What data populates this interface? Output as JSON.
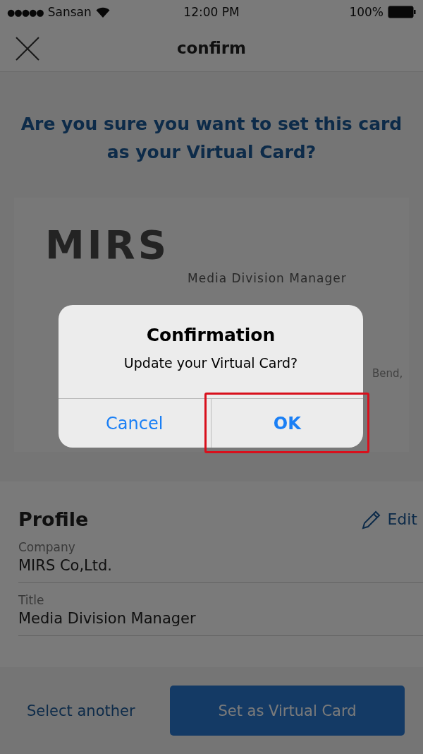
{
  "status_bar": {
    "signal_dots": "●●●●●",
    "carrier": "Sansan",
    "time": "12:00 PM",
    "battery": "100%"
  },
  "nav": {
    "title": "confirm"
  },
  "question": "Are you sure you want to set this card as your Virtual Card?",
  "card": {
    "logo": "MIRS",
    "title": "Media Division Manager",
    "address_visible": "Bend,"
  },
  "profile": {
    "heading": "Profile",
    "edit": "Edit",
    "fields": [
      {
        "label": "Company",
        "value": "MIRS Co,Ltd."
      },
      {
        "label": "Title",
        "value": "Media Division Manager"
      }
    ]
  },
  "footer": {
    "secondary": "Select another",
    "primary": "Set as Virtual Card"
  },
  "dialog": {
    "title": "Confirmation",
    "message": "Update your Virtual Card?",
    "buttons": [
      {
        "label": "Cancel",
        "kind": "normal",
        "highlighted": false
      },
      {
        "label": "OK",
        "kind": "bold",
        "highlighted": true
      }
    ]
  }
}
